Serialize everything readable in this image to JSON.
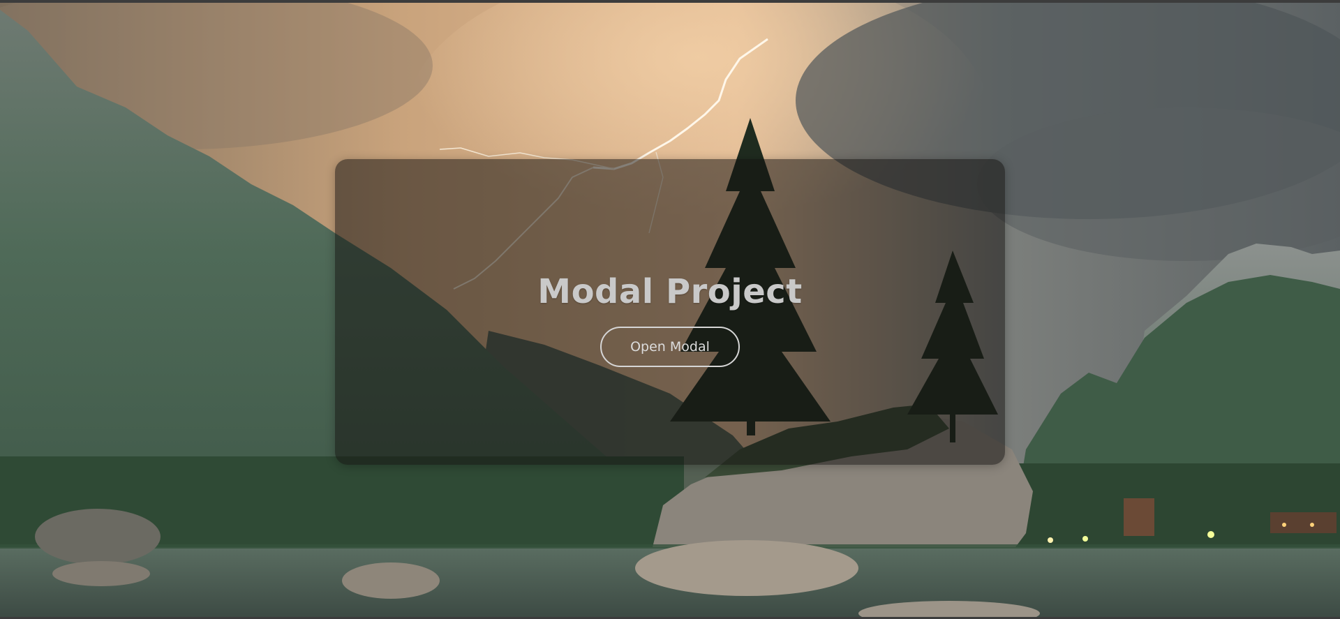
{
  "hero": {
    "title": "Modal Project",
    "open_button_label": "Open Modal"
  },
  "background": {
    "scene": "stormy-mountain-lake-icon"
  },
  "colors": {
    "overlay": "#141210",
    "title": "#c9c9c9",
    "button_border": "#d6d6d6",
    "sky_warm": "#d8b18c",
    "sky_storm": "#5c6264",
    "mountain_green": "#3f5a47",
    "water": "#51655a"
  }
}
